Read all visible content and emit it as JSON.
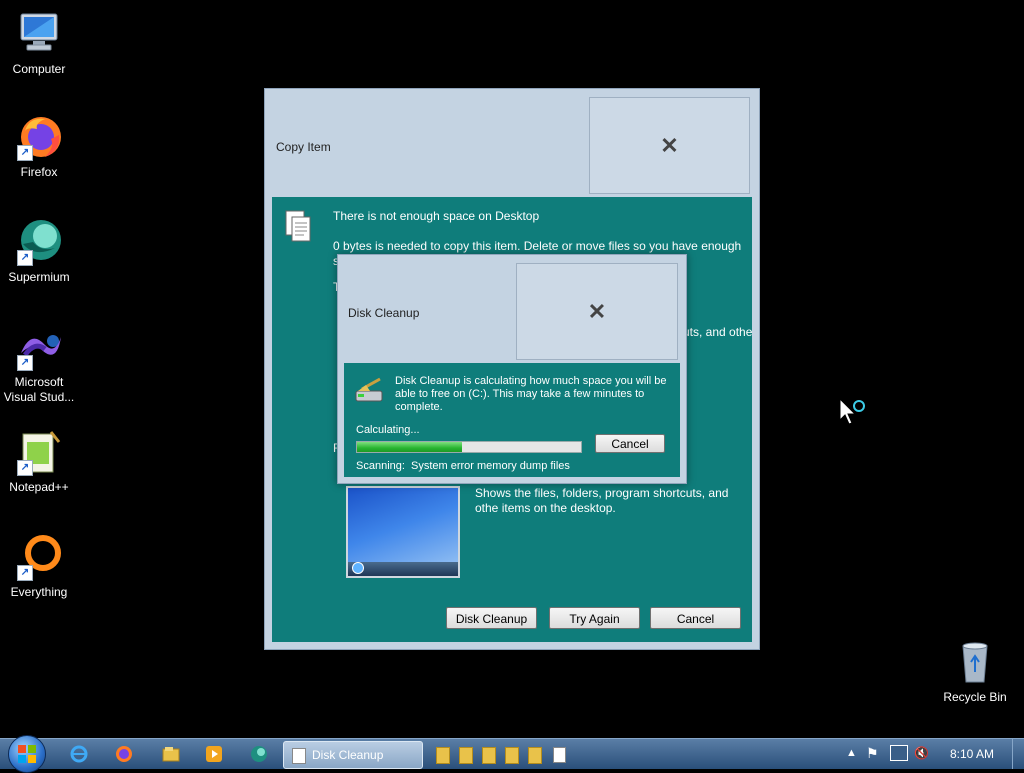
{
  "desktop": {
    "icons": [
      {
        "label": "Computer"
      },
      {
        "label": "Firefox"
      },
      {
        "label": "Supermium"
      },
      {
        "label": "Microsoft Visual Stud..."
      },
      {
        "label": "Notepad++"
      },
      {
        "label": "Everything"
      },
      {
        "label": "Recycle Bin"
      }
    ]
  },
  "copy_dialog": {
    "title": "Copy Item",
    "message_title": "There is not enough space on Desktop",
    "message_body": "0 bytes is needed to copy this item. Delete or move files so you have enough",
    "partial_s": "s",
    "partial_t": "T",
    "partial_f": "F",
    "partial_right_1": "cuts, and othe",
    "desktop_desc": "Shows the files, folders, program shortcuts, and othe items on the desktop.",
    "buttons": {
      "disk_cleanup": "Disk Cleanup",
      "try_again": "Try Again",
      "cancel": "Cancel"
    }
  },
  "cleanup_dialog": {
    "title": "Disk Cleanup",
    "message": "Disk Cleanup is calculating how much space you will be able to free on  (C:).  This may take a few minutes to complete.",
    "calculating_label": "Calculating...",
    "progress": 0.47,
    "cancel_label": "Cancel",
    "scanning_label": "Scanning:",
    "scanning_value": "System error memory dump files"
  },
  "taskbar": {
    "active_task": "Disk Cleanup",
    "clock": "8:10 AM",
    "folder_count": 5
  },
  "colors": {
    "teal": "#0f7d7b",
    "progress_green": "#2fc23c",
    "taskbar": "#2a4f7a"
  }
}
